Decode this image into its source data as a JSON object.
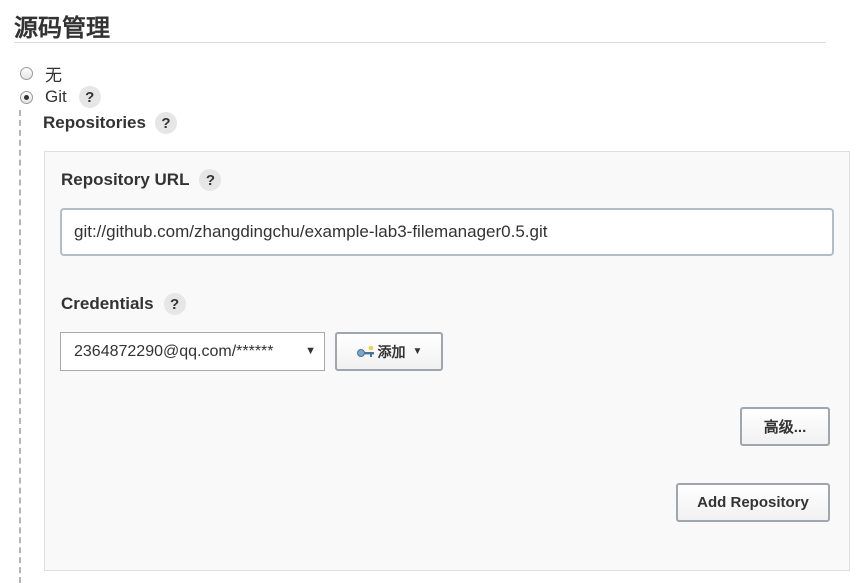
{
  "section": {
    "title": "源码管理"
  },
  "scm_options": [
    {
      "label": "无",
      "selected": false
    },
    {
      "label": "Git",
      "selected": true
    }
  ],
  "help": {
    "symbol": "?"
  },
  "repositories": {
    "label": "Repositories",
    "repository_url": {
      "label": "Repository URL",
      "value": "git://github.com/zhangdingchu/example-lab3-filemanager0.5.git"
    },
    "credentials": {
      "label": "Credentials",
      "selected": "2364872290@qq.com/******",
      "add_button": "添加"
    },
    "advanced_button": "高级...",
    "add_repository_button": "Add Repository"
  },
  "icons": {
    "key": "key-icon",
    "caret": "caret-down-icon",
    "select_arrow": "select-arrow-icon"
  }
}
